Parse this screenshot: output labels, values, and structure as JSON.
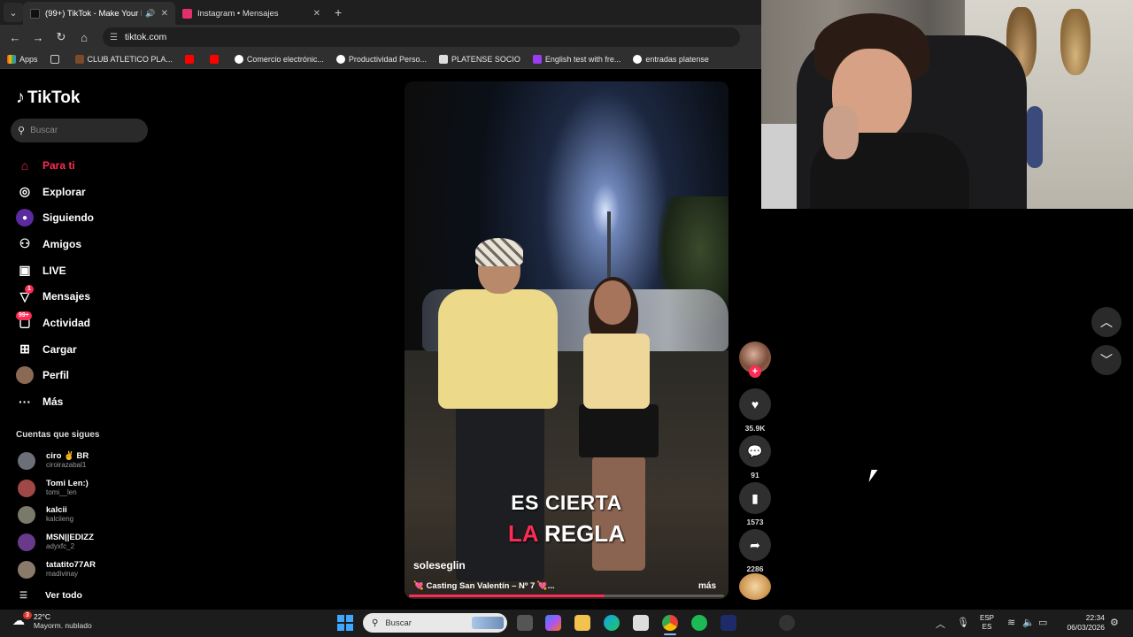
{
  "browser": {
    "tabs": [
      {
        "title": "(99+) TikTok - Make Your D",
        "active": true,
        "favicon_color": "#111111"
      },
      {
        "title": "Instagram • Mensajes",
        "active": false,
        "favicon_color": "#e1306c"
      }
    ],
    "url": "tiktok.com",
    "bookmarks": [
      {
        "label": "Apps",
        "icon": "apps-grid-icon"
      },
      {
        "label": "",
        "icon": "grid-icon"
      },
      {
        "label": "CLUB ATLETICO PLA...",
        "icon": "club-crest-icon"
      },
      {
        "label": "",
        "icon": "youtube-icon"
      },
      {
        "label": "",
        "icon": "youtube-icon"
      },
      {
        "label": "Comercio electrónic...",
        "icon": "google-icon"
      },
      {
        "label": "Productividad Perso...",
        "icon": "google-icon"
      },
      {
        "label": "PLATENSE SOCIO",
        "icon": "platense-icon"
      },
      {
        "label": "English test with fre...",
        "icon": "ef-icon"
      },
      {
        "label": "entradas platense",
        "icon": "globe-icon"
      }
    ]
  },
  "sidebar": {
    "logo": "TikTok",
    "search_placeholder": "Buscar",
    "menu": [
      {
        "label": "Para ti",
        "icon": "home-icon",
        "active": true
      },
      {
        "label": "Explorar",
        "icon": "compass-icon"
      },
      {
        "label": "Siguiendo",
        "icon": "following-icon"
      },
      {
        "label": "Amigos",
        "icon": "friends-icon"
      },
      {
        "label": "LIVE",
        "icon": "live-icon"
      },
      {
        "label": "Mensajes",
        "icon": "messages-icon",
        "badge": "1"
      },
      {
        "label": "Actividad",
        "icon": "activity-icon",
        "badge": "99+"
      },
      {
        "label": "Cargar",
        "icon": "upload-icon"
      },
      {
        "label": "Perfil",
        "icon": "profile-icon"
      },
      {
        "label": "Más",
        "icon": "more-icon"
      }
    ],
    "following_title": "Cuentas que sigues",
    "following": [
      {
        "name": "ciro ✌️ BR",
        "username": "ciroirazabal1"
      },
      {
        "name": "Tomi Len:)",
        "username": "tomi__len"
      },
      {
        "name": "kalcii",
        "username": "kalciieng"
      },
      {
        "name": "MSN||EDIZZ",
        "username": "adyxfc_2"
      },
      {
        "name": "tatatito77AR",
        "username": "madivinay"
      }
    ],
    "see_all": "Ver todo"
  },
  "video": {
    "caption_line1": "ES CIERTA",
    "caption_line2_red": "LA",
    "caption_line2_rest": "REGLA",
    "author": "soleseglin",
    "description": "💘 Casting San Valentín – Nº 7 💘...",
    "more": "más",
    "progress": 0.62
  },
  "actions": {
    "likes": "35.9K",
    "comments": "91",
    "saves": "1573",
    "shares": "2286"
  },
  "taskbar": {
    "weather_temp": "22°C",
    "weather_desc": "Mayorm. nublado",
    "weather_badge": "3",
    "search_placeholder": "Buscar",
    "lang_1": "ESP",
    "lang_2": "ES",
    "time": "22:34",
    "date": "06/03/2026"
  },
  "colors": {
    "accent": "#fe2c55",
    "chrome_bg": "#2f2f2f"
  }
}
